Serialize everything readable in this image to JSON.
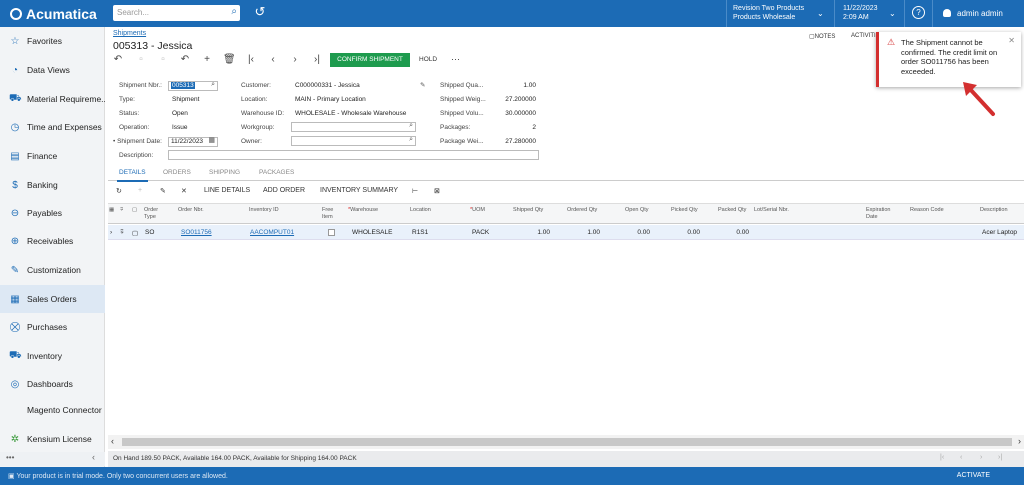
{
  "app": {
    "logo": "Acumatica"
  },
  "topbar": {
    "search_placeholder": "Search...",
    "branch_line1": "Revision Two Products",
    "branch_line2": "Products Wholesale",
    "date": "11/22/2023",
    "time": "2:09 AM",
    "help": "?",
    "user": "admin admin"
  },
  "sidebar": {
    "items": [
      {
        "label": "Favorites",
        "icon": "☆"
      },
      {
        "label": "Data Views",
        "icon": "◔"
      },
      {
        "label": "Material Requireme...",
        "icon": "⛟"
      },
      {
        "label": "Time and Expenses",
        "icon": "◷"
      },
      {
        "label": "Finance",
        "icon": "▤"
      },
      {
        "label": "Banking",
        "icon": "$"
      },
      {
        "label": "Payables",
        "icon": "⊖"
      },
      {
        "label": "Receivables",
        "icon": "⊕"
      },
      {
        "label": "Customization",
        "icon": "✎"
      },
      {
        "label": "Sales Orders",
        "icon": "▦"
      },
      {
        "label": "Purchases",
        "icon": "⛒"
      },
      {
        "label": "Inventory",
        "icon": "⛟"
      },
      {
        "label": "Dashboards",
        "icon": "◎"
      },
      {
        "label": "Magento Connector",
        "icon": ""
      },
      {
        "label": "Kensium License",
        "icon": "✲"
      }
    ],
    "bottom_dots": "•••",
    "collapse": "‹"
  },
  "page": {
    "breadcrumb": "Shipments",
    "title": "005313 - Jessica",
    "notes": "NOTES",
    "activities": "ACTIVITI"
  },
  "toolbar": {
    "confirm": "CONFIRM SHIPMENT",
    "hold": "HOLD",
    "more": "···"
  },
  "form": {
    "shipment_nbr_label": "Shipment Nbr.:",
    "shipment_nbr": "005313",
    "type_label": "Type:",
    "type": "Shipment",
    "status_label": "Status:",
    "status": "Open",
    "operation_label": "Operation:",
    "operation": "Issue",
    "shipment_date_label": "• Shipment Date:",
    "shipment_date": "11/22/2023",
    "description_label": "Description:",
    "customer_label": "Customer:",
    "customer": "C000000331 - Jessica",
    "location_label": "Location:",
    "location": "MAIN - Primary Location",
    "warehouse_label": "Warehouse ID:",
    "warehouse": "WHOLESALE - Wholesale Warehouse",
    "workgroup_label": "Workgroup:",
    "owner_label": "Owner:",
    "shipped_qty_label": "Shipped Qua...",
    "shipped_qty": "1.00",
    "shipped_weight_label": "Shipped Weig...",
    "shipped_weight": "27.200000",
    "shipped_volume_label": "Shipped Volu...",
    "shipped_volume": "30.000000",
    "packages_label": "Packages:",
    "packages": "2",
    "package_weight_label": "Package Wei...",
    "package_weight": "27.280000"
  },
  "tabs": [
    "DETAILS",
    "ORDERS",
    "SHIPPING",
    "PACKAGES"
  ],
  "grid_toolbar": {
    "line_details": "LINE DETAILS",
    "add_order": "ADD ORDER",
    "inventory_summary": "INVENTORY SUMMARY"
  },
  "grid": {
    "headers": {
      "order_type": "Order Type",
      "order_nbr": "Order Nbr.",
      "inventory_id": "Inventory ID",
      "free_item": "Free Item",
      "warehouse": "Warehouse",
      "location": "Location",
      "uom": "UOM",
      "shipped_qty": "Shipped Qty",
      "ordered_qty": "Ordered Qty",
      "open_qty": "Open Qty",
      "picked_qty": "Picked Qty",
      "packed_qty": "Packed Qty",
      "lot_serial": "Lot/Serial Nbr.",
      "expiration": "Expiration Date",
      "reason_code": "Reason Code",
      "description": "Description"
    },
    "row": {
      "order_type": "SO",
      "order_nbr": "SO011756",
      "inventory_id": "AACOMPUT01",
      "warehouse": "WHOLESALE",
      "location": "R1S1",
      "uom": "PACK",
      "shipped_qty": "1.00",
      "ordered_qty": "1.00",
      "open_qty": "0.00",
      "picked_qty": "0.00",
      "packed_qty": "0.00",
      "description": "Acer Laptop"
    }
  },
  "status_bar": "On Hand 189.50 PACK, Available 164.00 PACK, Available for Shipping 164.00 PACK",
  "trial": {
    "message": "Your product is in trial mode. Only two concurrent users are allowed.",
    "activate": "ACTIVATE"
  },
  "toast": {
    "message": "The Shipment cannot be confirmed.  The credit limit on order SO011756 has been exceeded."
  },
  "colors": {
    "brand": "#1c6bb5",
    "confirm": "#1e9b4e",
    "error": "#d32f2f"
  }
}
